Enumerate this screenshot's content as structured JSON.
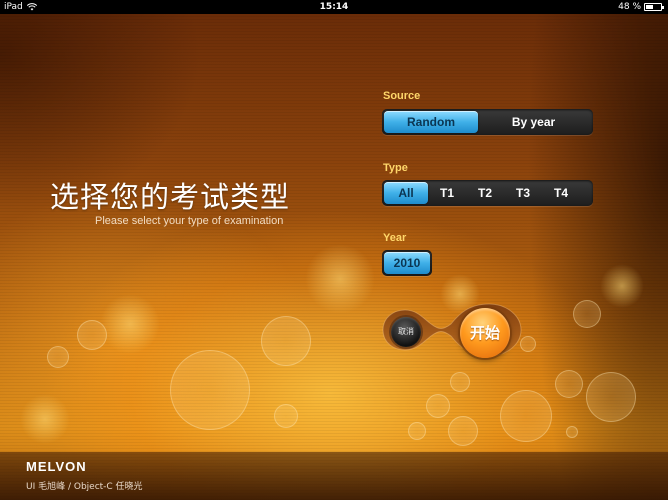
{
  "status_bar": {
    "device": "iPad",
    "time": "15:14",
    "battery": "48 %",
    "battery_level": 0.48,
    "wifi_icon": "wifi-icon",
    "battery_icon": "battery-icon"
  },
  "hero": {
    "title": "选择您的考试类型",
    "subtitle": "Please select your type of examination"
  },
  "source": {
    "label": "Source",
    "options": [
      "Random",
      "By year"
    ],
    "selected": "Random"
  },
  "type": {
    "label": "Type",
    "options": [
      "All",
      "T1",
      "T2",
      "T3",
      "T4"
    ],
    "selected": "All"
  },
  "year": {
    "label": "Year",
    "options": [
      "2010"
    ],
    "selected": "2010"
  },
  "actions": {
    "cancel_label": "取消",
    "start_label": "开始"
  },
  "footer": {
    "brand": "MELVON",
    "credits": "UI 毛旭峰 / Object-C 任晓光"
  },
  "colors": {
    "accent_blue": "#3fb0e8",
    "label_yellow": "#ffd76a",
    "start_orange": "#ff9a1e",
    "background_orange": "#b2620f"
  }
}
